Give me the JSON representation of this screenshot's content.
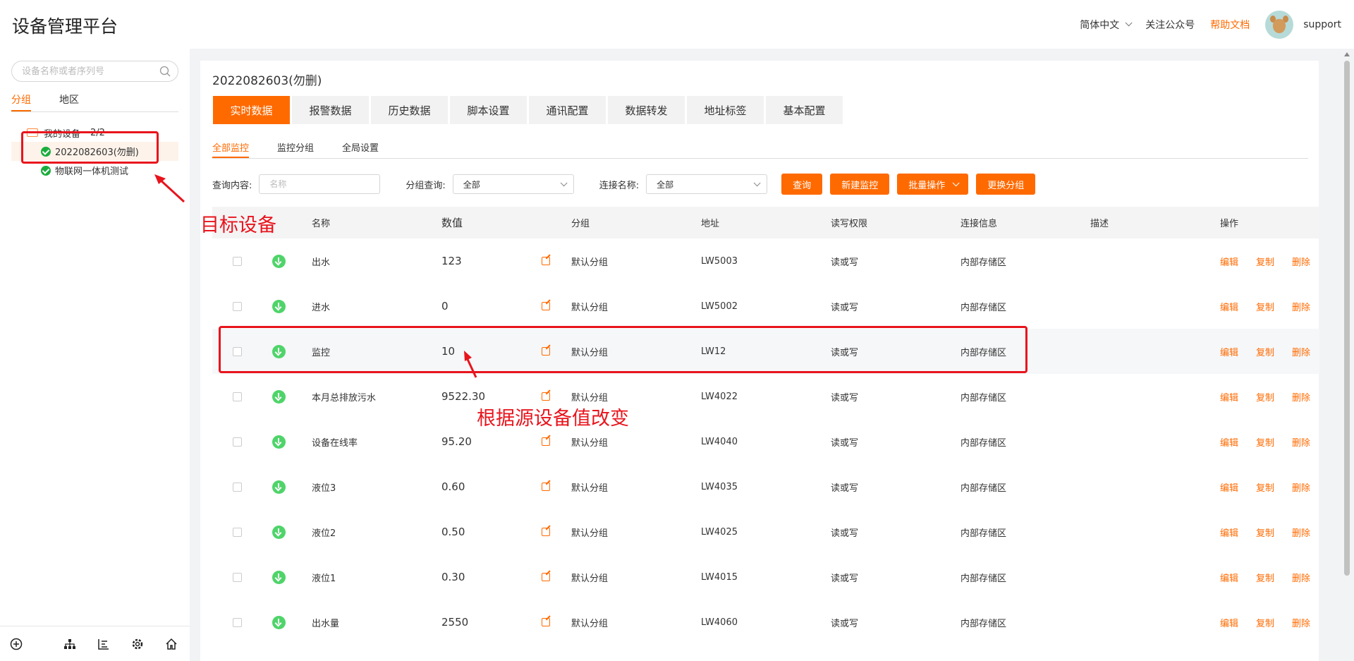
{
  "header": {
    "app_title": "设备管理平台",
    "language": "简体中文",
    "follow": "关注公众号",
    "help": "帮助文档",
    "username": "support"
  },
  "sidebar": {
    "search_placeholder": "设备名称或者序列号",
    "tabs": [
      "分组",
      "地区"
    ],
    "tree_root": {
      "label": "我的设备",
      "count": "2/2"
    },
    "devices": [
      "2022082603(勿删)",
      "物联网一体机测试"
    ]
  },
  "main": {
    "device_title": "2022082603(勿删)",
    "tabs": [
      "实时数据",
      "报警数据",
      "历史数据",
      "脚本设置",
      "通讯配置",
      "数据转发",
      "地址标签",
      "基本配置"
    ],
    "sub_tabs": [
      "全部监控",
      "监控分组",
      "全局设置"
    ],
    "filters": {
      "query_label": "查询内容:",
      "query_placeholder": "名称",
      "group_label": "分组查询:",
      "group_value": "全部",
      "conn_label": "连接名称:",
      "conn_value": "全部"
    },
    "buttons": {
      "query": "查询",
      "new": "新建监控",
      "batch": "批量操作",
      "change_group": "更换分组"
    },
    "table": {
      "headers": [
        "名称",
        "数值",
        "分组",
        "地址",
        "读写权限",
        "连接信息",
        "描述",
        "操作"
      ],
      "ops": [
        "编辑",
        "复制",
        "删除"
      ],
      "rows": [
        {
          "name": "出水",
          "value": "123",
          "group": "默认分组",
          "addr": "LW5003",
          "perm": "读或写",
          "conn": "内部存储区"
        },
        {
          "name": "进水",
          "value": "0",
          "group": "默认分组",
          "addr": "LW5002",
          "perm": "读或写",
          "conn": "内部存储区"
        },
        {
          "name": "监控",
          "value": "10",
          "group": "默认分组",
          "addr": "LW12",
          "perm": "读或写",
          "conn": "内部存储区"
        },
        {
          "name": "本月总排放污水",
          "value": "9522.30",
          "group": "默认分组",
          "addr": "LW4022",
          "perm": "读或写",
          "conn": "内部存储区"
        },
        {
          "name": "设备在线率",
          "value": "95.20",
          "group": "默认分组",
          "addr": "LW4040",
          "perm": "读或写",
          "conn": "内部存储区"
        },
        {
          "name": "液位3",
          "value": "0.60",
          "group": "默认分组",
          "addr": "LW4035",
          "perm": "读或写",
          "conn": "内部存储区"
        },
        {
          "name": "液位2",
          "value": "0.50",
          "group": "默认分组",
          "addr": "LW4025",
          "perm": "读或写",
          "conn": "内部存储区"
        },
        {
          "name": "液位1",
          "value": "0.30",
          "group": "默认分组",
          "addr": "LW4015",
          "perm": "读或写",
          "conn": "内部存储区"
        },
        {
          "name": "出水量",
          "value": "2550",
          "group": "默认分组",
          "addr": "LW4060",
          "perm": "读或写",
          "conn": "内部存储区"
        }
      ]
    }
  },
  "annotations": {
    "target_device": "目标设备",
    "value_changes": "根据源设备值改变"
  },
  "colors": {
    "accent": "#ff6a00",
    "annotation": "#e8141c",
    "online": "#1aad3c"
  }
}
